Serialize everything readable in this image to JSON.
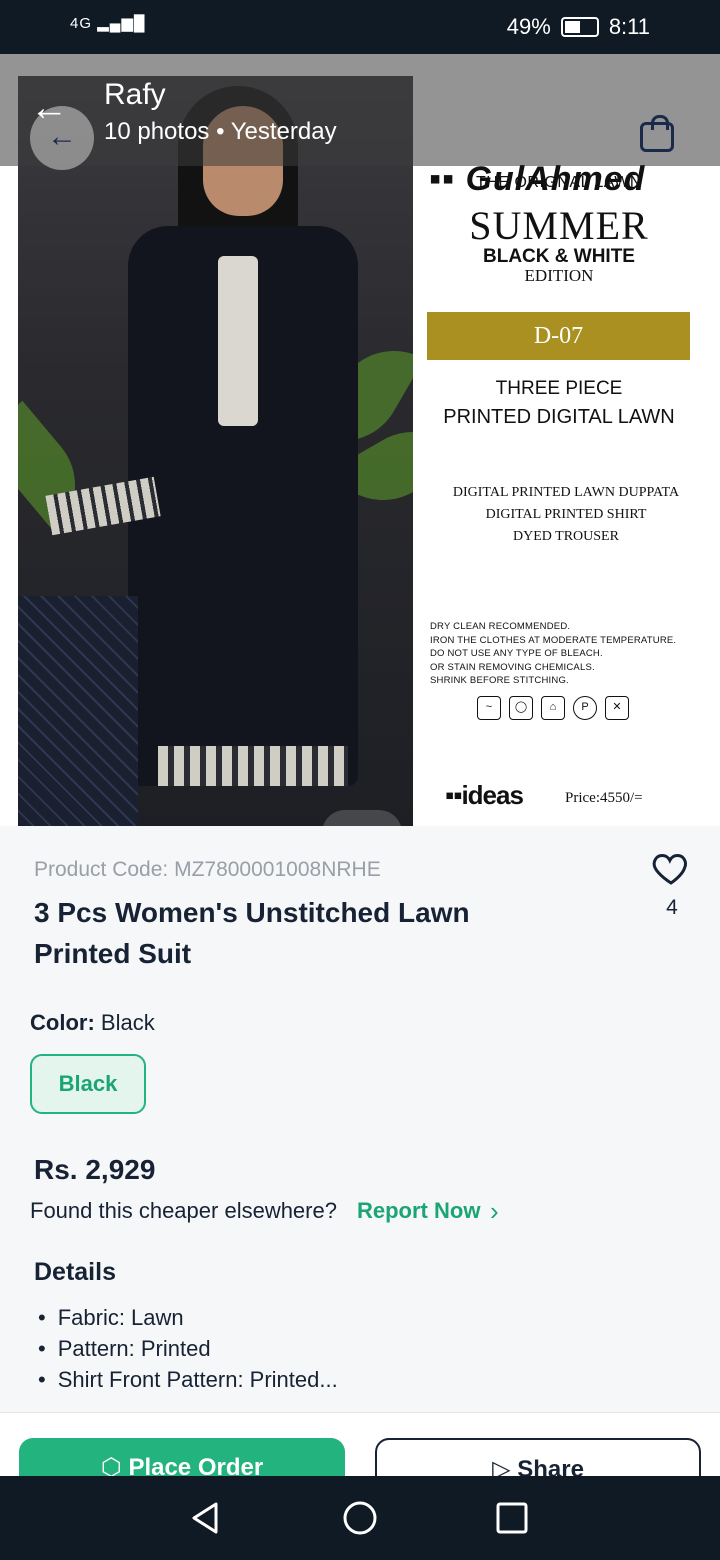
{
  "status_bar": {
    "signal": "4G",
    "battery": "49%",
    "time": "8:11",
    "battery_level": 0.49
  },
  "viewer": {
    "sender": "Rafy",
    "photo_count": "10 photos",
    "separator": "•",
    "when": "Yesterday",
    "active_photo": 1,
    "total_dots": 2
  },
  "product_image": {
    "brand": "GulAhmed",
    "line1": "THE ORIGNAL LAWN",
    "line2": "SUMMER",
    "line3": "BLACK & WHITE",
    "line4": "EDITION",
    "design_code": "D-07",
    "line5": "THREE PIECE",
    "line6": "PRINTED DIGITAL LAWN",
    "components": [
      "DIGITAL PRINTED LAWN DUPPATA",
      "DIGITAL PRINTED SHIRT",
      "DYED TROUSER"
    ],
    "care": [
      "DRY CLEAN RECOMMENDED.",
      "IRON THE CLOTHES AT MODERATE TEMPERATURE.",
      "DO NOT USE ANY TYPE OF BLEACH.",
      "OR STAIN REMOVING CHEMICALS.",
      "SHRINK BEFORE STITCHING."
    ],
    "retailer": "ideas",
    "price_tag": "Price:4550/="
  },
  "product": {
    "code": "Product Code: MZ7800001008NRHE",
    "title": "3 Pcs Women's Unstitched Lawn Printed Suit",
    "likes": "4",
    "color_label": "Color:",
    "color_value": "Black",
    "color_options": [
      "Black"
    ],
    "price": "Rs. 2,929",
    "cheaper_text": "Found this cheaper elsewhere?",
    "report_link": "Report Now",
    "details_title": "Details",
    "details": [
      "Fabric: Lawn",
      "Pattern: Printed",
      "Shirt Front Pattern: Printed..."
    ]
  },
  "actions": {
    "primary": "Place Order",
    "secondary": "Share"
  },
  "colors": {
    "accent": "#22b37e",
    "text_dark": "#172334",
    "gold": "#a99020"
  }
}
